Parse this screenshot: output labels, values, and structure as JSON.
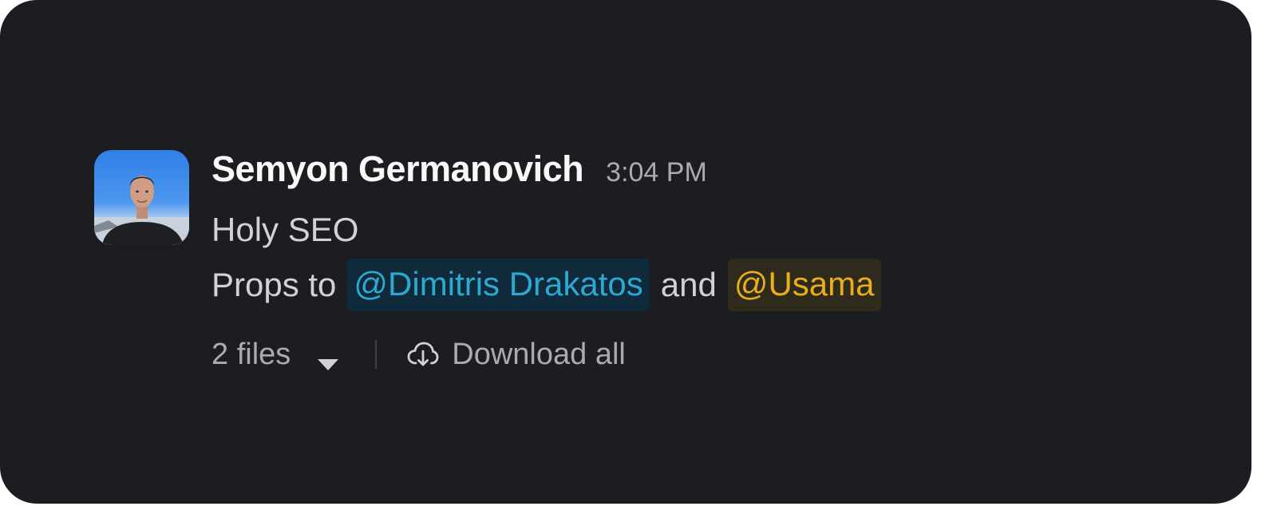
{
  "message": {
    "sender_name": "Semyon Germanovich",
    "timestamp": "3:04 PM",
    "line_1": "Holy SEO",
    "line_2_prefix": "Props to",
    "mention_1": "@Dimitris Drakatos",
    "connector": "and",
    "mention_2": "@Usama"
  },
  "attachments": {
    "files_label": "2 files",
    "download_all_label": "Download all",
    "toggle_icon": "caret-down-icon",
    "download_icon": "cloud-download-icon"
  },
  "colors": {
    "background": "#1b1d21",
    "mention_blue": "#2fa8d1",
    "mention_blue_bg": "#0e2a3b",
    "mention_yellow": "#e8ae1b",
    "mention_yellow_bg": "#2e2a1c"
  }
}
